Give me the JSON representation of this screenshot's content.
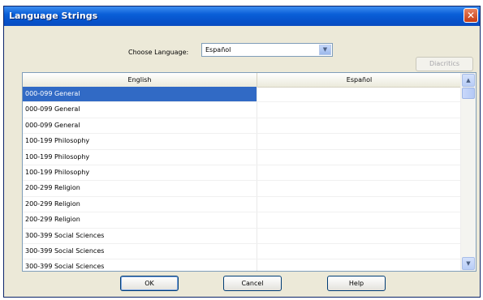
{
  "window": {
    "title": "Language Strings",
    "close_label": "✕"
  },
  "language": {
    "label": "Choose Language:",
    "selected": "Español",
    "dropdown_arrow": "▼"
  },
  "buttons": {
    "diacritics": "Diacritics",
    "ok": "OK",
    "cancel": "Cancel",
    "help": "Help"
  },
  "grid": {
    "columns": [
      "English",
      "Español"
    ],
    "rows": [
      {
        "english": "000-099 General",
        "spanish": ""
      },
      {
        "english": "000-099 General",
        "spanish": ""
      },
      {
        "english": "000-099 General",
        "spanish": ""
      },
      {
        "english": "100-199 Philosophy",
        "spanish": ""
      },
      {
        "english": "100-199 Philosophy",
        "spanish": ""
      },
      {
        "english": "100-199 Philosophy",
        "spanish": ""
      },
      {
        "english": "200-299 Religion",
        "spanish": ""
      },
      {
        "english": "200-299 Religion",
        "spanish": ""
      },
      {
        "english": "200-299 Religion",
        "spanish": ""
      },
      {
        "english": "300-399 Social Sciences",
        "spanish": ""
      },
      {
        "english": "300-399 Social Sciences",
        "spanish": ""
      },
      {
        "english": "300-399 Social Sciences",
        "spanish": ""
      }
    ],
    "selected_row": 0
  },
  "scrollbar": {
    "up_arrow": "▲",
    "down_arrow": "▼"
  },
  "colors": {
    "titlebar": "#0a5fd8",
    "selection": "#316ac5",
    "window_bg": "#ece9d8"
  }
}
